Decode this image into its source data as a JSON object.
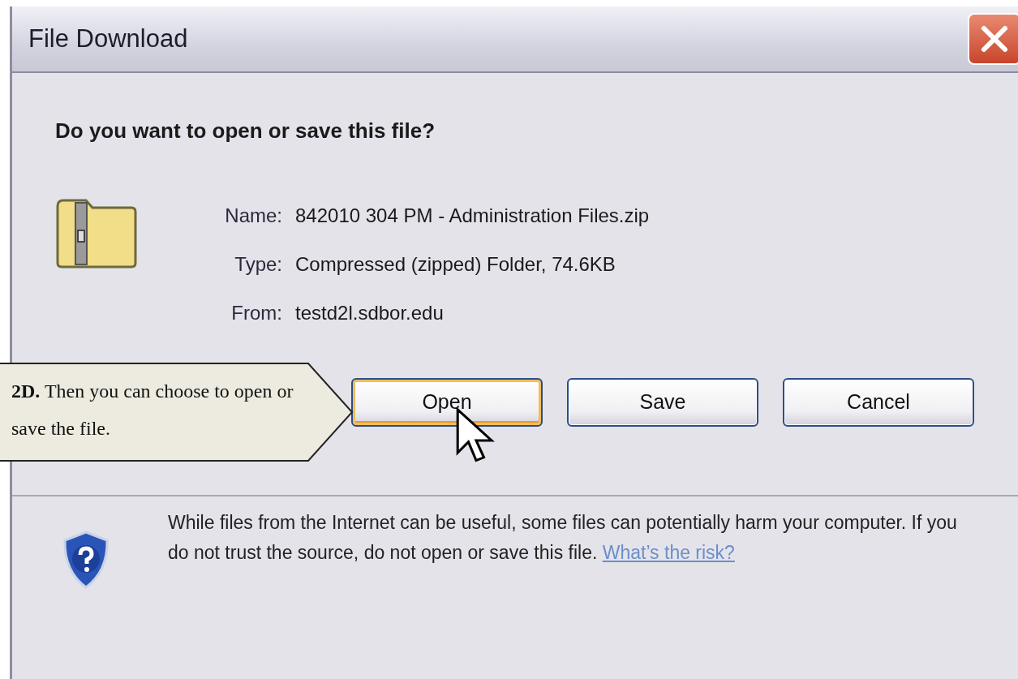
{
  "window": {
    "title": "File Download"
  },
  "question": "Do you want to open or save this file?",
  "file_info": [
    {
      "label": "Name:",
      "value": "842010 304 PM - Administration Files.zip"
    },
    {
      "label": "Type:",
      "value": "Compressed (zipped) Folder, 74.6KB"
    },
    {
      "label": "From:",
      "value": "testd2l.sdbor.edu"
    }
  ],
  "buttons": [
    {
      "label": "Open",
      "focused": true
    },
    {
      "label": "Save",
      "focused": false
    },
    {
      "label": "Cancel",
      "focused": false
    }
  ],
  "warning": {
    "text": "While files from the Internet can be useful, some files can potentially harm your computer. If you do not trust the source, do not open or save this file.",
    "link": "What’s the risk?"
  },
  "callout": {
    "text": "**2D.** Then you can choose to open or save the file."
  }
}
